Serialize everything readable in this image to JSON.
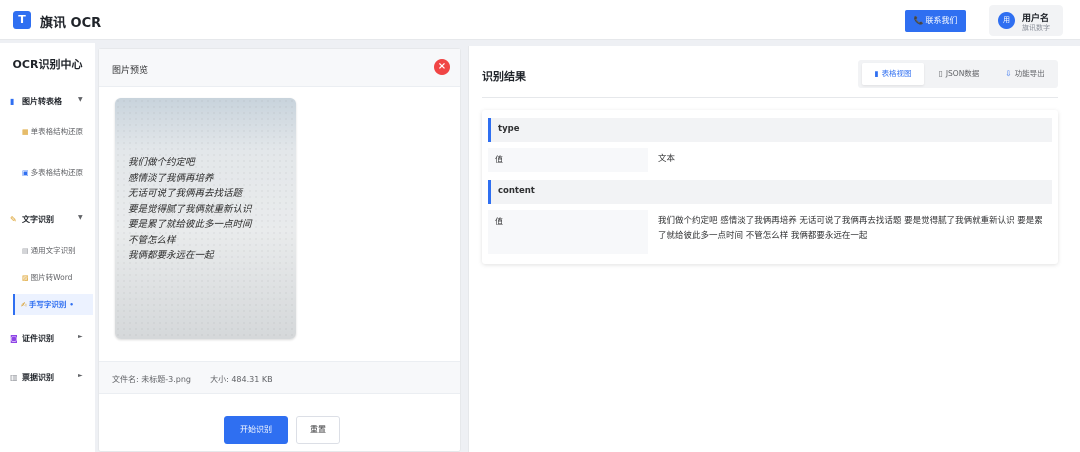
{
  "header": {
    "logo": "T",
    "title": "旗讯 OCR",
    "contact_icon": "phone-icon",
    "contact_label": "联系我们",
    "user_avatar": "用",
    "user_name": "用户名",
    "user_org": "旗讯数字"
  },
  "sidebar": {
    "title": "OCR识别中心",
    "groups": [
      {
        "label": "图片转表格",
        "icon": "chart-icon",
        "arrow": "▼",
        "items": [
          {
            "label": "单表格结构还原",
            "icon": "table-icon"
          },
          {
            "label": "多表格结构还原",
            "icon": "multi-table-icon"
          }
        ]
      },
      {
        "label": "文字识别",
        "icon": "text-icon",
        "arrow": "▼",
        "items": [
          {
            "label": "通用文字识别",
            "icon": "doc-icon"
          },
          {
            "label": "图片转Word",
            "icon": "word-icon"
          },
          {
            "label": "手写字识别",
            "icon": "pen-icon",
            "active": true
          }
        ]
      },
      {
        "label": "证件识别",
        "icon": "id-icon",
        "arrow": "►",
        "items": []
      },
      {
        "label": "票据识别",
        "icon": "receipt-icon",
        "arrow": "►",
        "items": []
      }
    ]
  },
  "preview": {
    "title": "图片预览",
    "close_icon": "close-icon",
    "handwriting_lines": [
      "我们做个约定吧",
      "感情淡了我俩再培养",
      "无话可说了我俩再去找话题",
      "要是觉得腻了我俩就重新认识",
      "要是累了就给彼此多一点时间",
      "不管怎么样",
      "我俩都要永远在一起"
    ],
    "file_name_label": "文件名:",
    "file_name": "未标题-3.png",
    "file_size_label": "大小:",
    "file_size": "484.31 KB",
    "start_label": "开始识别",
    "reset_label": "重置"
  },
  "result": {
    "title": "识别结果",
    "tabs": [
      {
        "label": "表格视图",
        "icon": "bar-chart-icon",
        "active": true
      },
      {
        "label": "JSON数据",
        "icon": "json-file-icon",
        "active": false
      },
      {
        "label": "功能导出",
        "icon": "export-icon",
        "active": false
      }
    ],
    "fields": [
      {
        "name": "type",
        "label": "值",
        "value": "文本"
      },
      {
        "name": "content",
        "label": "值",
        "value": "我们做个约定吧 感情淡了我俩再培养 无话可说了我俩再去找话题 要是觉得腻了我俩就重新认识 要是累了就给彼此多一点时间 不管怎么样 我俩都要永远在一起"
      }
    ]
  }
}
